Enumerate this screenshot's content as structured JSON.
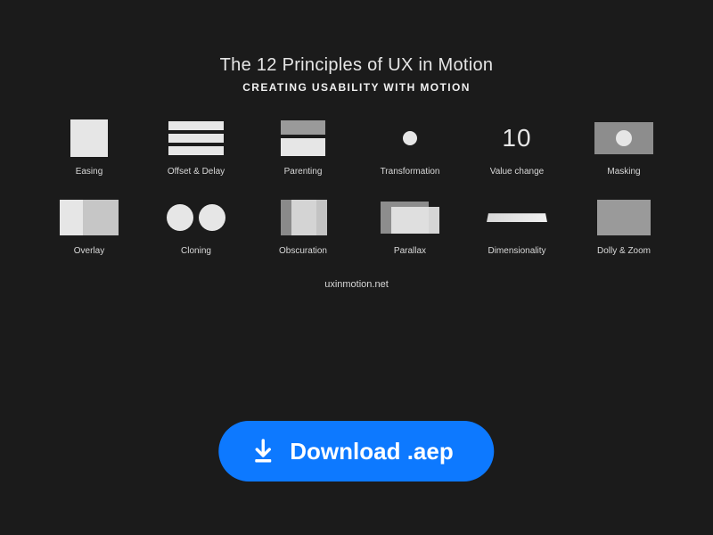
{
  "header": {
    "title": "The 12 Principles of UX in Motion",
    "subtitle": "CREATING USABILITY WITH MOTION"
  },
  "principles": [
    {
      "label": "Easing"
    },
    {
      "label": "Offset & Delay"
    },
    {
      "label": "Parenting"
    },
    {
      "label": "Transformation"
    },
    {
      "label": "Value change",
      "value": "10"
    },
    {
      "label": "Masking"
    },
    {
      "label": "Overlay"
    },
    {
      "label": "Cloning"
    },
    {
      "label": "Obscuration"
    },
    {
      "label": "Parallax"
    },
    {
      "label": "Dimensionality"
    },
    {
      "label": "Dolly & Zoom"
    }
  ],
  "site_url": "uxinmotion.net",
  "download_button": "Download .aep"
}
